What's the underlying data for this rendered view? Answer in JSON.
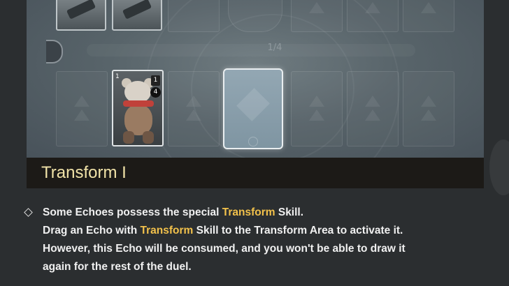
{
  "board": {
    "page_indicator": "1/4",
    "top_card_icons": [
      "mech-icon",
      "mech-icon"
    ],
    "top_slot_icons": [
      "crest-icon",
      "triangle-icon",
      "triangle-icon",
      "triangle-icon"
    ],
    "bottom_slot_icon": "double-triangle-icon",
    "selected_echo": {
      "name": "teddy-bear-echo",
      "cost": "1",
      "stat_top": "1",
      "stat_bottom": "4"
    },
    "transform_area_icon": "crest-icon"
  },
  "header": {
    "title": "Transform I"
  },
  "tips": {
    "bullet_icon": "diamond-bullet-icon",
    "line1_pre": "Some Echoes possess the special ",
    "line1_hl": "Transform",
    "line1_post": " Skill.",
    "line2_pre": "Drag an Echo with ",
    "line2_hl": "Transform",
    "line2_post": " Skill to the Transform Area to activate it.",
    "line3": "However, this Echo will be consumed, and you won't be able to draw it",
    "line4": "again for the rest of the duel."
  },
  "colors": {
    "highlight": "#f2c14b",
    "title": "#f1e3a8",
    "title_bar": "#1c1a17"
  }
}
